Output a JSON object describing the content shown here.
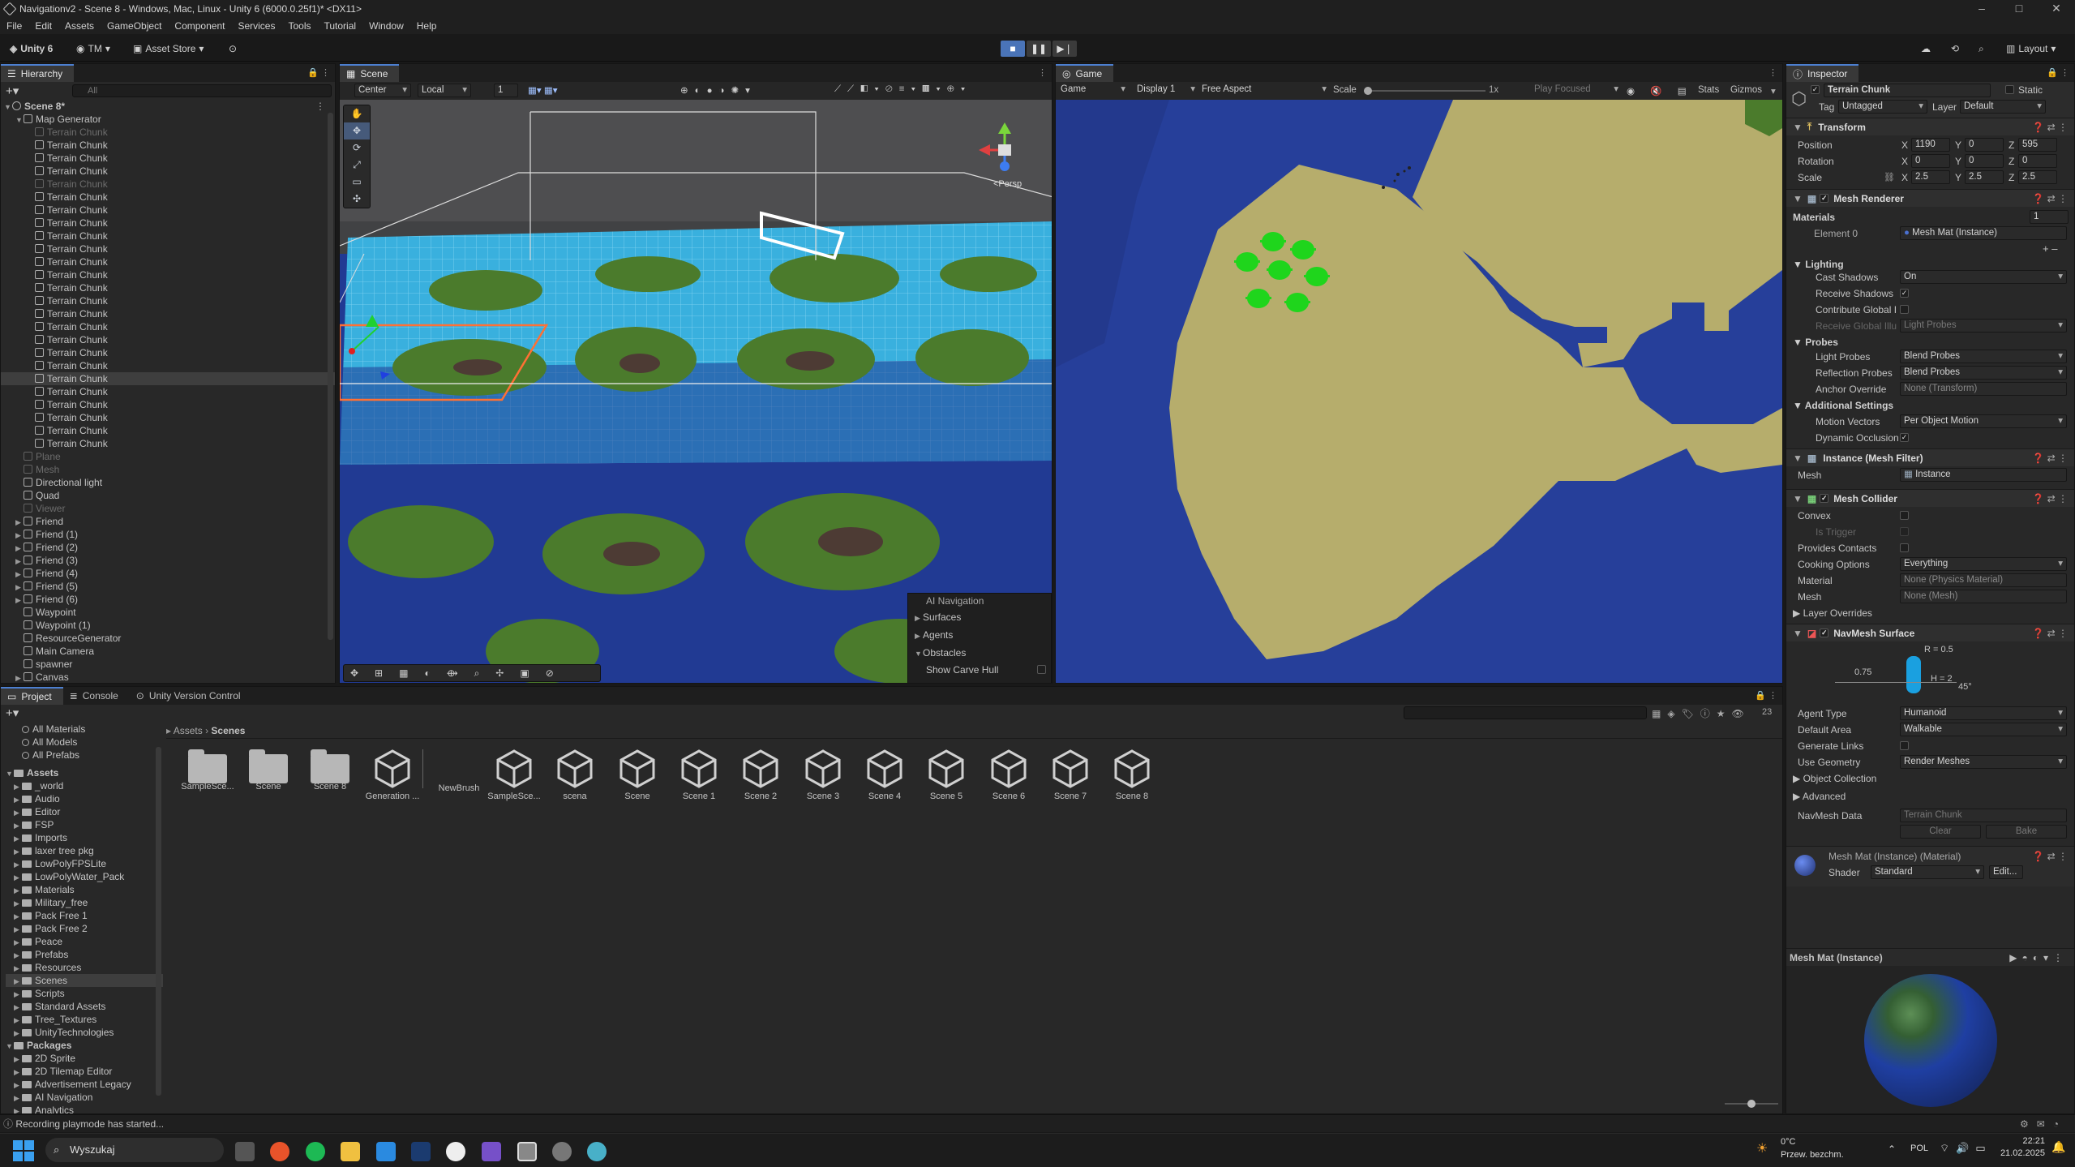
{
  "window": {
    "title": "Navigationv2 - Scene 8 - Windows, Mac, Linux - Unity 6 (6000.0.25f1)* <DX11>"
  },
  "menu": [
    "File",
    "Edit",
    "Assets",
    "GameObject",
    "Component",
    "Services",
    "Tools",
    "Tutorial",
    "Window",
    "Help"
  ],
  "toolbar": {
    "unity": "Unity 6",
    "account": "TM",
    "asset_store": "Asset Store",
    "layout": "Layout"
  },
  "hierarchy": {
    "tab": "Hierarchy",
    "search_placeholder": "All",
    "items": [
      {
        "label": "Scene 8*",
        "depth": 0,
        "kind": "scene",
        "state": "normal"
      },
      {
        "label": "Map Generator",
        "depth": 1,
        "kind": "obj",
        "state": "normal"
      },
      {
        "label": "Terrain Chunk",
        "depth": 2,
        "state": "dim"
      },
      {
        "label": "Terrain Chunk",
        "depth": 2,
        "state": "normal"
      },
      {
        "label": "Terrain Chunk",
        "depth": 2,
        "state": "normal"
      },
      {
        "label": "Terrain Chunk",
        "depth": 2,
        "state": "normal"
      },
      {
        "label": "Terrain Chunk",
        "depth": 2,
        "state": "dim"
      },
      {
        "label": "Terrain Chunk",
        "depth": 2,
        "state": "normal"
      },
      {
        "label": "Terrain Chunk",
        "depth": 2,
        "state": "normal"
      },
      {
        "label": "Terrain Chunk",
        "depth": 2,
        "state": "normal"
      },
      {
        "label": "Terrain Chunk",
        "depth": 2,
        "state": "normal"
      },
      {
        "label": "Terrain Chunk",
        "depth": 2,
        "state": "normal"
      },
      {
        "label": "Terrain Chunk",
        "depth": 2,
        "state": "normal"
      },
      {
        "label": "Terrain Chunk",
        "depth": 2,
        "state": "normal"
      },
      {
        "label": "Terrain Chunk",
        "depth": 2,
        "state": "normal"
      },
      {
        "label": "Terrain Chunk",
        "depth": 2,
        "state": "normal"
      },
      {
        "label": "Terrain Chunk",
        "depth": 2,
        "state": "normal"
      },
      {
        "label": "Terrain Chunk",
        "depth": 2,
        "state": "normal"
      },
      {
        "label": "Terrain Chunk",
        "depth": 2,
        "state": "normal"
      },
      {
        "label": "Terrain Chunk",
        "depth": 2,
        "state": "normal"
      },
      {
        "label": "Terrain Chunk",
        "depth": 2,
        "state": "normal"
      },
      {
        "label": "Terrain Chunk",
        "depth": 2,
        "state": "selected"
      },
      {
        "label": "Terrain Chunk",
        "depth": 2,
        "state": "normal"
      },
      {
        "label": "Terrain Chunk",
        "depth": 2,
        "state": "normal"
      },
      {
        "label": "Terrain Chunk",
        "depth": 2,
        "state": "normal"
      },
      {
        "label": "Terrain Chunk",
        "depth": 2,
        "state": "normal"
      },
      {
        "label": "Terrain Chunk",
        "depth": 2,
        "state": "normal"
      },
      {
        "label": "Plane",
        "depth": 1,
        "state": "dim"
      },
      {
        "label": "Mesh",
        "depth": 1,
        "state": "dim"
      },
      {
        "label": "Directional light",
        "depth": 1,
        "state": "normal"
      },
      {
        "label": "Quad",
        "depth": 1,
        "state": "normal"
      },
      {
        "label": "Viewer",
        "depth": 1,
        "state": "dim"
      },
      {
        "label": "Friend",
        "depth": 1,
        "state": "normal",
        "collapsed": true
      },
      {
        "label": "Friend (1)",
        "depth": 1,
        "state": "normal",
        "collapsed": true
      },
      {
        "label": "Friend (2)",
        "depth": 1,
        "state": "normal",
        "collapsed": true
      },
      {
        "label": "Friend (3)",
        "depth": 1,
        "state": "normal",
        "collapsed": true
      },
      {
        "label": "Friend (4)",
        "depth": 1,
        "state": "normal",
        "collapsed": true
      },
      {
        "label": "Friend (5)",
        "depth": 1,
        "state": "normal",
        "collapsed": true
      },
      {
        "label": "Friend (6)",
        "depth": 1,
        "state": "normal",
        "collapsed": true
      },
      {
        "label": "Waypoint",
        "depth": 1,
        "state": "normal"
      },
      {
        "label": "Waypoint (1)",
        "depth": 1,
        "state": "normal"
      },
      {
        "label": "ResourceGenerator",
        "depth": 1,
        "state": "normal"
      },
      {
        "label": "Main Camera",
        "depth": 1,
        "state": "normal"
      },
      {
        "label": "spawner",
        "depth": 1,
        "state": "normal"
      },
      {
        "label": "Canvas",
        "depth": 1,
        "state": "normal",
        "collapsed": true
      }
    ]
  },
  "scene": {
    "tab": "Scene",
    "pivot": "Center",
    "space": "Local",
    "snap": "1",
    "persp": "<Persp",
    "overlay": {
      "title": "AI Navigation",
      "items": [
        "Surfaces",
        "Agents",
        "Obstacles"
      ],
      "toggle": "Show Carve Hull"
    }
  },
  "game": {
    "tab": "Game",
    "mode": "Game",
    "display": "Display 1",
    "aspect": "Free Aspect",
    "scale_label": "Scale",
    "scale_val": "1x",
    "play_focused": "Play Focused",
    "stats": "Stats",
    "gizmos": "Gizmos"
  },
  "inspector": {
    "tab": "Inspector",
    "name": "Terrain Chunk",
    "static": "Static",
    "tag_label": "Tag",
    "tag": "Untagged",
    "layer_label": "Layer",
    "layer": "Default",
    "transform": {
      "title": "Transform",
      "position": {
        "label": "Position",
        "x": "1190",
        "y": "0",
        "z": "595"
      },
      "rotation": {
        "label": "Rotation",
        "x": "0",
        "y": "0",
        "z": "0"
      },
      "scale": {
        "label": "Scale",
        "x": "2.5",
        "y": "2.5",
        "z": "2.5"
      }
    },
    "mesh_renderer": {
      "title": "Mesh Renderer",
      "materials": "Materials",
      "count": "1",
      "element": "Element 0",
      "element_val": "Mesh Mat (Instance)",
      "lighting": "Lighting",
      "cast_shadows": "Cast Shadows",
      "cast_shadows_val": "On",
      "receive_shadows": "Receive Shadows",
      "contribute_gi": "Contribute Global I",
      "receive_gi": "Receive Global Illu",
      "receive_gi_val": "Light Probes",
      "probes": "Probes",
      "light_probes": "Light Probes",
      "light_probes_val": "Blend Probes",
      "reflection_probes": "Reflection Probes",
      "reflection_probes_val": "Blend Probes",
      "anchor_override": "Anchor Override",
      "anchor_override_val": "None (Transform)",
      "additional": "Additional Settings",
      "motion_vectors": "Motion Vectors",
      "motion_vectors_val": "Per Object Motion",
      "dynamic_occlusion": "Dynamic Occlusion"
    },
    "mesh_filter": {
      "title": "Instance (Mesh Filter)",
      "mesh": "Mesh",
      "mesh_val": "Instance"
    },
    "mesh_collider": {
      "title": "Mesh Collider",
      "convex": "Convex",
      "is_trigger": "Is Trigger",
      "provides_contacts": "Provides Contacts",
      "cooking": "Cooking Options",
      "cooking_val": "Everything",
      "material": "Material",
      "material_val": "None (Physics Material)",
      "mesh": "Mesh",
      "mesh_val": "None (Mesh)",
      "layer_overrides": "Layer Overrides"
    },
    "navmesh": {
      "title": "NavMesh Surface",
      "r": "R = 0.5",
      "h": "H = 2",
      "step": "0.75",
      "angle": "45°",
      "agent_type": "Agent Type",
      "agent_type_val": "Humanoid",
      "default_area": "Default Area",
      "default_area_val": "Walkable",
      "generate_links": "Generate Links",
      "use_geometry": "Use Geometry",
      "use_geometry_val": "Render Meshes",
      "object_collection": "Object Collection",
      "advanced": "Advanced",
      "navmesh_data": "NavMesh Data",
      "navmesh_data_val": "Terrain Chunk",
      "clear": "Clear",
      "bake": "Bake"
    },
    "material": {
      "title": "Mesh Mat (Instance) (Material)",
      "shader": "Shader",
      "shader_val": "Standard",
      "edit": "Edit..."
    },
    "preview": "Mesh Mat (Instance)"
  },
  "project": {
    "tabs": [
      "Project",
      "Console",
      "Unity Version Control"
    ],
    "favorites": [
      "All Materials",
      "All Models",
      "All Prefabs"
    ],
    "assets_root": "Assets",
    "folders": [
      "_world",
      "Audio",
      "Editor",
      "FSP",
      "Imports",
      "laxer tree pkg",
      "LowPolyFPSLite",
      "LowPolyWater_Pack",
      "Materials",
      "Military_free",
      "Pack Free 1",
      "Pack Free 2",
      "Peace",
      "Prefabs",
      "Resources",
      "Scenes",
      "Scripts",
      "Standard Assets",
      "Tree_Textures",
      "UnityTechnologies"
    ],
    "packages_root": "Packages",
    "packages": [
      "2D Sprite",
      "2D Tilemap Editor",
      "Advertisement Legacy",
      "AI Navigation",
      "Analytics"
    ],
    "breadcrumb": [
      "Assets",
      "Scenes"
    ],
    "count": "23",
    "grid": [
      {
        "label": "SampleSce...",
        "type": "folder"
      },
      {
        "label": "Scene",
        "type": "folder"
      },
      {
        "label": "Scene 8",
        "type": "folder"
      },
      {
        "label": "Generation ...",
        "type": "unity"
      },
      {
        "label": "NewBrush",
        "type": "brush"
      },
      {
        "label": "SampleSce...",
        "type": "unity"
      },
      {
        "label": "scena",
        "type": "unity"
      },
      {
        "label": "Scene",
        "type": "unity"
      },
      {
        "label": "Scene 1",
        "type": "unity"
      },
      {
        "label": "Scene 2",
        "type": "unity"
      },
      {
        "label": "Scene 3",
        "type": "unity"
      },
      {
        "label": "Scene 4",
        "type": "unity"
      },
      {
        "label": "Scene 5",
        "type": "unity"
      },
      {
        "label": "Scene 6",
        "type": "unity"
      },
      {
        "label": "Scene 7",
        "type": "unity"
      },
      {
        "label": "Scene 8",
        "type": "unity"
      }
    ]
  },
  "status": {
    "message": "Recording playmode has started..."
  },
  "taskbar": {
    "search": "Wyszukaj",
    "weather_temp": "0°C",
    "weather_desc": "Przew. bezchm.",
    "lang": "POL",
    "time": "22:21",
    "date": "21.02.2025"
  },
  "colors": {
    "accent": "#4c7fd0",
    "water": "#253f9a",
    "sand": "#b6ad6c",
    "navmesh": "#3ab5e5",
    "grass": "#4a7a2c",
    "agent": "#1fd51c"
  }
}
